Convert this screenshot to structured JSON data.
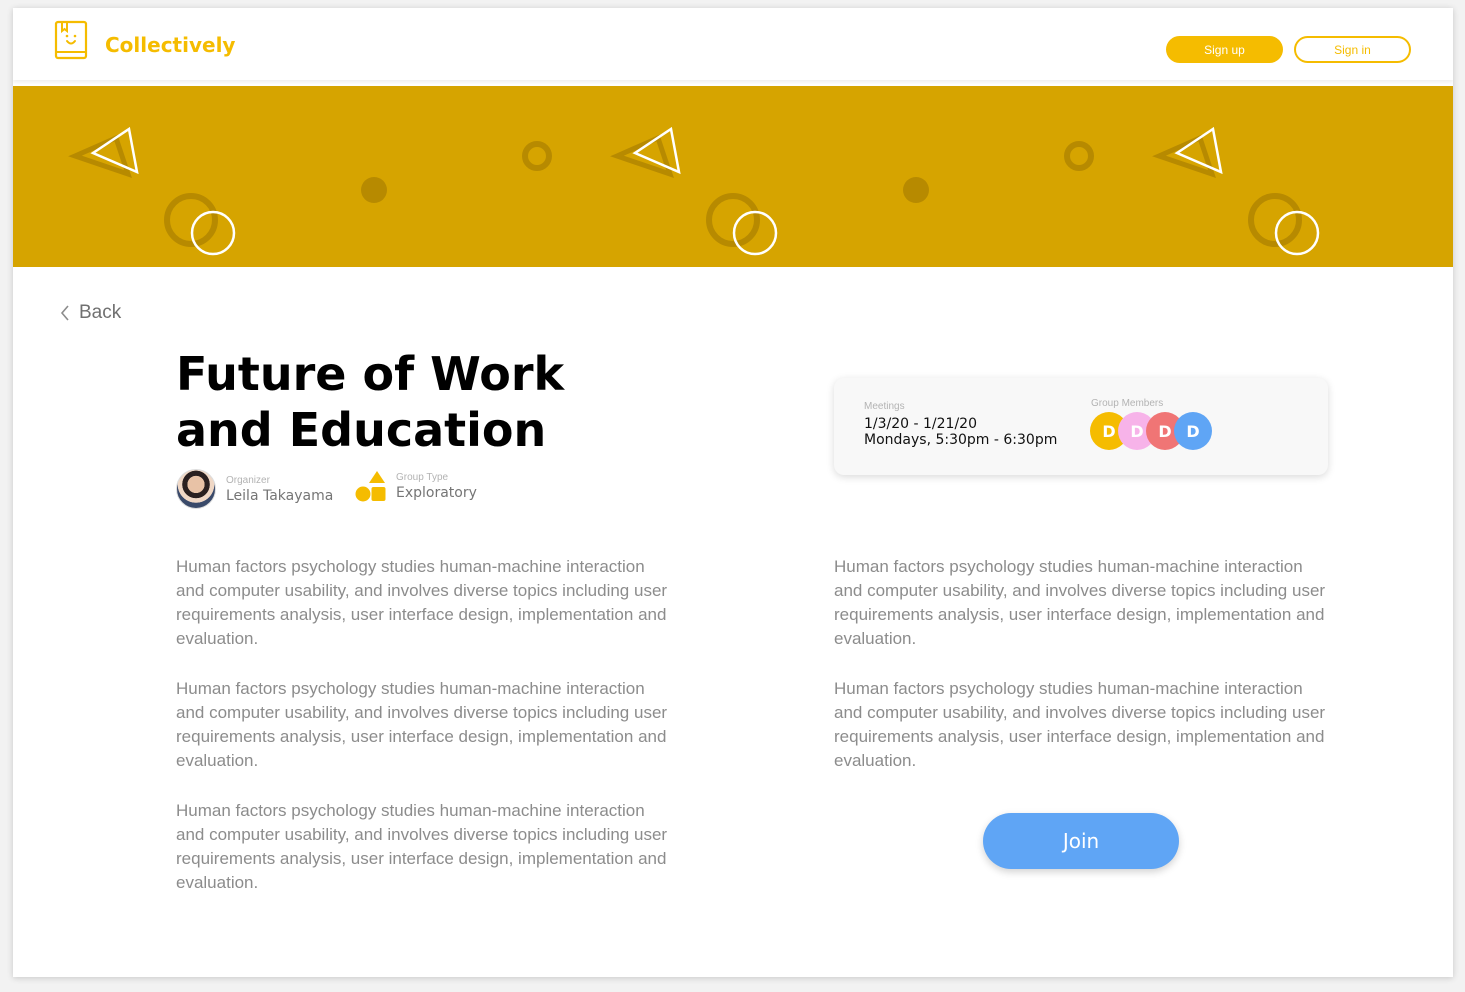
{
  "header": {
    "brand": "Collectively",
    "signup_label": "Sign up",
    "signin_label": "Sign in"
  },
  "back_label": "Back",
  "group": {
    "title": "Future of Work and Education",
    "organizer_label": "Organizer",
    "organizer_name": "Leila Takayama",
    "type_label": "Group Type",
    "type_value": "Exploratory"
  },
  "description": {
    "left": [
      "Human factors psychology studies human-machine interaction and computer usability, and involves diverse topics including user requirements analysis, user interface design, implementation and evaluation.",
      "Human factors psychology studies human-machine interaction and computer usability, and involves diverse topics including user requirements analysis, user interface design, implementation and evaluation.",
      "Human factors psychology studies human-machine interaction and computer usability, and involves diverse topics including user requirements analysis, user interface design, implementation and evaluation."
    ],
    "right": [
      "Human factors psychology studies human-machine interaction and computer usability, and involves diverse topics including user requirements analysis, user interface design, implementation and evaluation.",
      "Human factors psychology studies human-machine interaction and computer usability, and involves diverse topics including user requirements analysis, user interface design, implementation and evaluation."
    ]
  },
  "meetings": {
    "label": "Meetings",
    "dates": "1/3/20 - 1/21/20",
    "schedule": "Mondays, 5:30pm - 6:30pm"
  },
  "members": {
    "label": "Group Members",
    "initials": [
      "D",
      "D",
      "D",
      "D"
    ],
    "colors": [
      "#f5bc00",
      "#f7b3e9",
      "#f07575",
      "#5fa5f5"
    ]
  },
  "join_label": "Join",
  "colors": {
    "brand": "#f5bc00",
    "banner": "#d6a400",
    "join": "#5fa5f5"
  }
}
